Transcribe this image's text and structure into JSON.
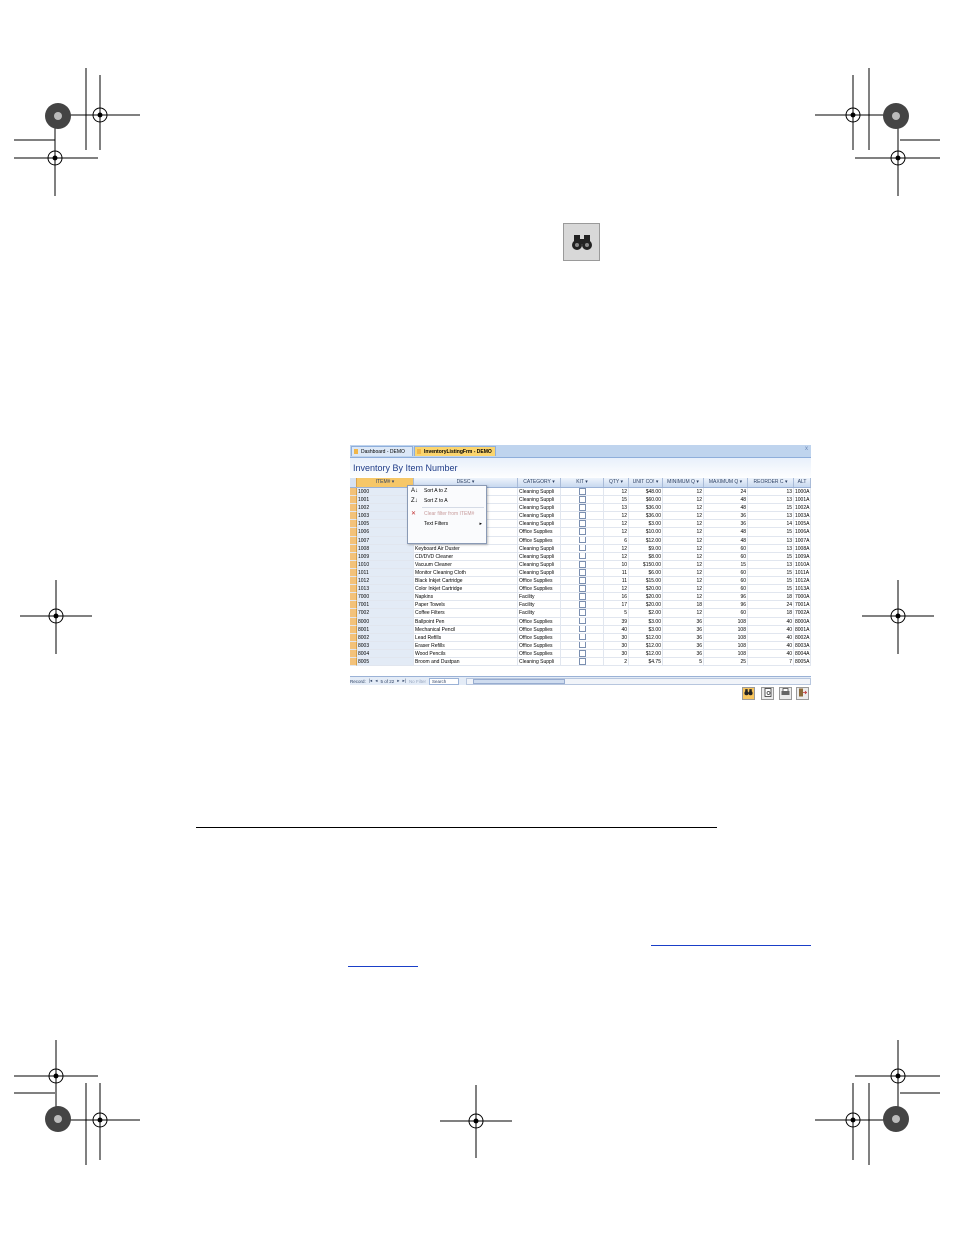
{
  "toolbar": {
    "find_icon": "binoculars-icon"
  },
  "window": {
    "tabs": [
      "Dashboard - DEMO",
      "InventoryListingFrm - DEMO"
    ],
    "close": "x",
    "title": "Inventory By Item Number",
    "columns": [
      "ITEM#",
      "DESC",
      "CATEGORY",
      "KIT",
      "QTY",
      "UNIT CO!",
      "MINIMUM Q",
      "MAXIMUM Q",
      "REORDER C",
      "ALT"
    ],
    "dropdown_glyph": "▾",
    "rows": [
      {
        "item": "1000",
        "desc": "",
        "cat": "Cleaning Suppli",
        "qty": "12",
        "unit": "$48.00",
        "min": "12",
        "max": "24",
        "reo": "13",
        "alt": "1000A"
      },
      {
        "item": "1001",
        "desc": "",
        "cat": "Cleaning Suppli",
        "qty": "15",
        "unit": "$60.00",
        "min": "12",
        "max": "48",
        "reo": "13",
        "alt": "1001A"
      },
      {
        "item": "1002",
        "desc": "",
        "cat": "Cleaning Suppli",
        "qty": "13",
        "unit": "$36.00",
        "min": "12",
        "max": "48",
        "reo": "15",
        "alt": "1002A"
      },
      {
        "item": "1003",
        "desc": "",
        "cat": "Cleaning Suppli",
        "qty": "12",
        "unit": "$36.00",
        "min": "12",
        "max": "36",
        "reo": "13",
        "alt": "1003A"
      },
      {
        "item": "1005",
        "desc": "",
        "cat": "Cleaning Suppli",
        "qty": "12",
        "unit": "$3.00",
        "min": "12",
        "max": "36",
        "reo": "14",
        "alt": "1005A"
      },
      {
        "item": "1006",
        "desc": "",
        "cat": "Office Supplies",
        "qty": "12",
        "unit": "$10.00",
        "min": "12",
        "max": "48",
        "reo": "15",
        "alt": "1006A"
      },
      {
        "item": "1007",
        "desc": "",
        "cat": "Office Supplies",
        "qty": "6",
        "unit": "$12.00",
        "min": "12",
        "max": "48",
        "reo": "13",
        "alt": "1007A"
      },
      {
        "item": "1008",
        "desc": "Keyboard Air Duster",
        "cat": "Cleaning Suppli",
        "qty": "12",
        "unit": "$9.00",
        "min": "12",
        "max": "60",
        "reo": "13",
        "alt": "1008A"
      },
      {
        "item": "1009",
        "desc": "CD/DVD Cleaner",
        "cat": "Cleaning Suppli",
        "qty": "12",
        "unit": "$8.00",
        "min": "12",
        "max": "60",
        "reo": "15",
        "alt": "1009A"
      },
      {
        "item": "1010",
        "desc": "Vacuum Cleaner",
        "cat": "Cleaning Suppli",
        "qty": "10",
        "unit": "$150.00",
        "min": "12",
        "max": "15",
        "reo": "13",
        "alt": "1010A"
      },
      {
        "item": "1011",
        "desc": "Monitor Cleaning Cloth",
        "cat": "Cleaning Suppli",
        "qty": "11",
        "unit": "$6.00",
        "min": "12",
        "max": "60",
        "reo": "15",
        "alt": "1011A"
      },
      {
        "item": "1012",
        "desc": "Black Inkjet Cartridge",
        "cat": "Office Supplies",
        "qty": "11",
        "unit": "$15.00",
        "min": "12",
        "max": "60",
        "reo": "15",
        "alt": "1012A"
      },
      {
        "item": "1013",
        "desc": "Color Inkjet Cartridge",
        "cat": "Office Supplies",
        "qty": "12",
        "unit": "$20.00",
        "min": "12",
        "max": "60",
        "reo": "15",
        "alt": "1013A"
      },
      {
        "item": "7000",
        "desc": "Napkins",
        "cat": "Facility",
        "qty": "16",
        "unit": "$20.00",
        "min": "12",
        "max": "96",
        "reo": "18",
        "alt": "7000A"
      },
      {
        "item": "7001",
        "desc": "Paper Towels",
        "cat": "Facility",
        "qty": "17",
        "unit": "$20.00",
        "min": "18",
        "max": "96",
        "reo": "24",
        "alt": "7001A"
      },
      {
        "item": "7002",
        "desc": "Coffee Filters",
        "cat": "Facility",
        "qty": "5",
        "unit": "$2.00",
        "min": "12",
        "max": "60",
        "reo": "18",
        "alt": "7002A"
      },
      {
        "item": "8000",
        "desc": "Ballpoint Pen",
        "cat": "Office Supplies",
        "qty": "39",
        "unit": "$3.00",
        "min": "36",
        "max": "108",
        "reo": "40",
        "alt": "8000A"
      },
      {
        "item": "8001",
        "desc": "Mechanical Pencil",
        "cat": "Office Supplies",
        "qty": "40",
        "unit": "$3.00",
        "min": "36",
        "max": "108",
        "reo": "40",
        "alt": "8001A"
      },
      {
        "item": "8002",
        "desc": "Lead Refills",
        "cat": "Office Supplies",
        "qty": "30",
        "unit": "$12.00",
        "min": "36",
        "max": "108",
        "reo": "40",
        "alt": "8002A"
      },
      {
        "item": "8003",
        "desc": "Eraser Refills",
        "cat": "Office Supplies",
        "qty": "30",
        "unit": "$12.00",
        "min": "36",
        "max": "108",
        "reo": "40",
        "alt": "8003A"
      },
      {
        "item": "8004",
        "desc": "Wood Pencils",
        "cat": "Office Supplies",
        "qty": "30",
        "unit": "$12.00",
        "min": "36",
        "max": "108",
        "reo": "40",
        "alt": "8004A"
      },
      {
        "item": "8005",
        "desc": "Broom and Dustpan",
        "cat": "Cleaning Suppli",
        "qty": "2",
        "unit": "$4.75",
        "min": "5",
        "max": "25",
        "reo": "7",
        "alt": "8005A"
      }
    ],
    "menu": {
      "items": [
        {
          "icon": "A↓",
          "label": "Sort A to Z",
          "disabled": false
        },
        {
          "icon": "Z↓",
          "label": "Sort Z to A",
          "disabled": false
        },
        {
          "icon": "✕",
          "label": "Clear filter from ITEM#",
          "disabled": true
        },
        {
          "icon": "",
          "label": "Text Filters",
          "disabled": false,
          "arrow": "▸"
        }
      ]
    },
    "status": {
      "record_label": "Record:",
      "first": "|◂",
      "prev": "◂",
      "position": "5 of 22",
      "next": "▸",
      "last": "▸|",
      "filter": "No Filter",
      "search": "Search"
    },
    "buttons": [
      "binoculars-icon",
      "preview-icon",
      "print-icon",
      "exit-icon"
    ]
  }
}
